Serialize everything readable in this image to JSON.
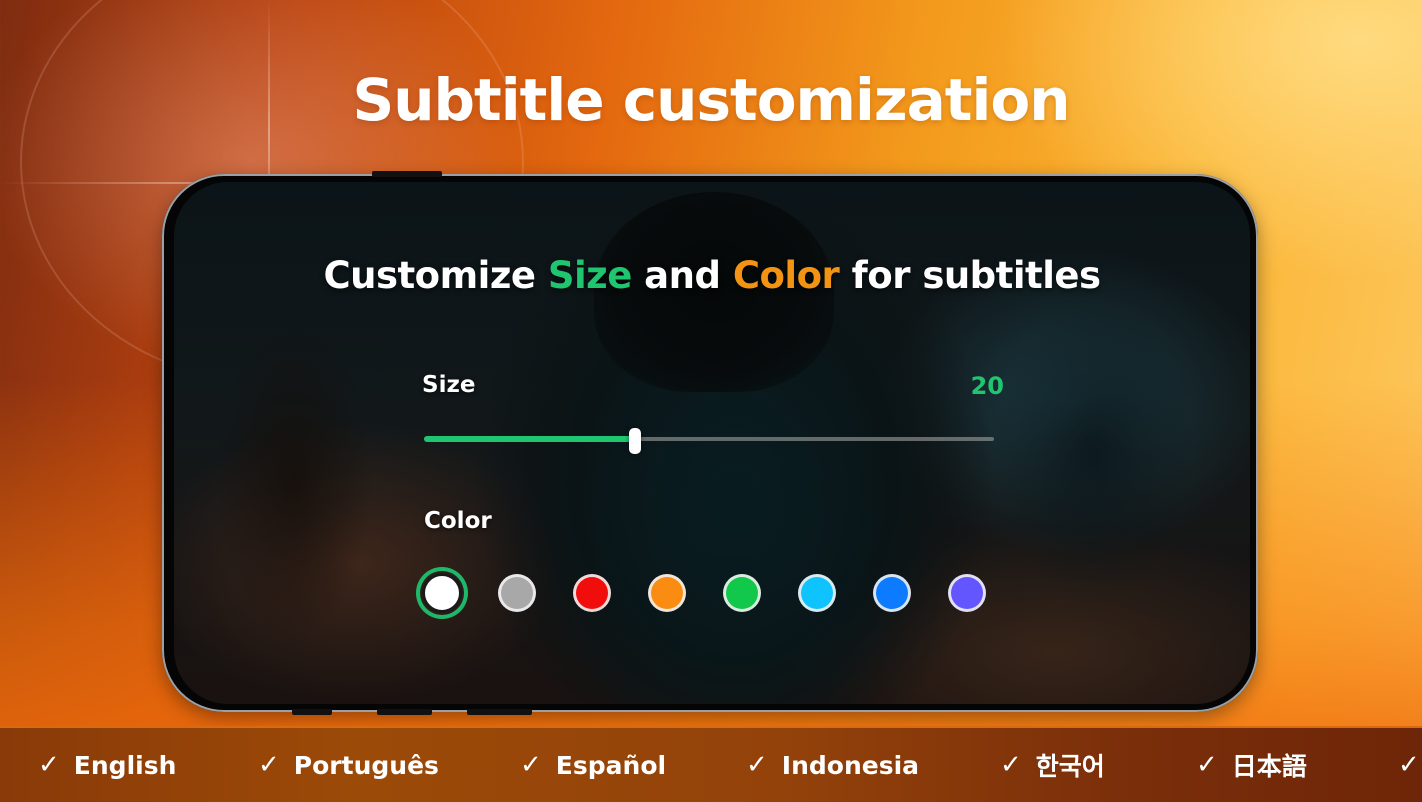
{
  "headline": "Subtitle customization",
  "screen": {
    "title_parts": {
      "prefix": "Customize ",
      "highlight1": "Size",
      "middle": " and ",
      "highlight2": "Color",
      "suffix": " for subtitles"
    },
    "size": {
      "label": "Size",
      "value": "20",
      "slider_fraction": 0.37,
      "accent_color": "#1fc56f"
    },
    "color": {
      "label": "Color",
      "selected_index": 0,
      "swatches": [
        {
          "name": "white",
          "hex": "#ffffff"
        },
        {
          "name": "gray",
          "hex": "#a8a8a8"
        },
        {
          "name": "red",
          "hex": "#f20d0d"
        },
        {
          "name": "orange",
          "hex": "#fb8c12"
        },
        {
          "name": "green",
          "hex": "#12c84a"
        },
        {
          "name": "light-blue",
          "hex": "#0fc3ff"
        },
        {
          "name": "blue",
          "hex": "#0d7bff"
        },
        {
          "name": "violet",
          "hex": "#6456ff"
        }
      ]
    }
  },
  "languages": {
    "check_icon": "check-icon",
    "items": [
      "English",
      "Português",
      "Español",
      "Indonesia",
      "한국어",
      "日本語",
      ""
    ]
  }
}
